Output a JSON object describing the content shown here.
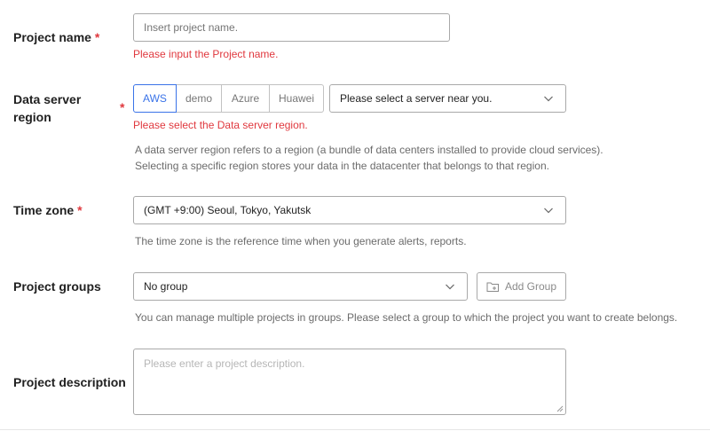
{
  "project_name": {
    "label": "Project name",
    "required_mark": "*",
    "placeholder": "Insert project name.",
    "error": "Please input the Project name."
  },
  "data_server_region": {
    "label_line1": "Data server",
    "label_line2": "region",
    "required_mark": "*",
    "providers": [
      "AWS",
      "demo",
      "Azure",
      "Huawei"
    ],
    "active_provider": "AWS",
    "server_select_value": "Please select a server near you.",
    "error": "Please select the Data server region.",
    "help_line1": "A data server region refers to a region (a bundle of data centers installed to provide cloud services).",
    "help_line2": "Selecting a specific region stores your data in the datacenter that belongs to that region."
  },
  "time_zone": {
    "label": "Time zone",
    "required_mark": "*",
    "value": "(GMT +9:00) Seoul, Tokyo, Yakutsk",
    "help": "The time zone is the reference time when you generate alerts, reports."
  },
  "project_groups": {
    "label": "Project groups",
    "value": "No group",
    "add_button_label": "Add Group",
    "add_button_icon": "folder-add-icon",
    "help": "You can manage multiple projects in groups. Please select a group to which the project you want to create belongs."
  },
  "project_description": {
    "label": "Project description",
    "placeholder": "Please enter a project description."
  },
  "colors": {
    "required": "#e0383e",
    "accent": "#3a73e8",
    "help_text": "#6b6b6b"
  }
}
